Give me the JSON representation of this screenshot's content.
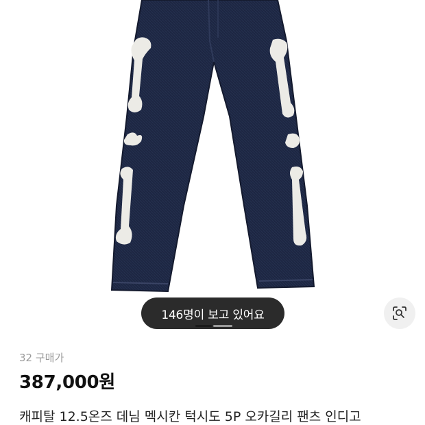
{
  "product": {
    "viewers_text": "146명이 보고 있어요",
    "purchase_count": "32 구매가",
    "price": "387,000원",
    "title": "캐피탈 12.5온즈 데님 멕시칸 턱시도 5P 오카길리 팬츠 인디고"
  },
  "icons": {
    "image_search": "lens-search-icon"
  },
  "colors": {
    "pill_background": "#2b2b2b",
    "denim": "#1c2540",
    "bone": "#ecebe6"
  }
}
